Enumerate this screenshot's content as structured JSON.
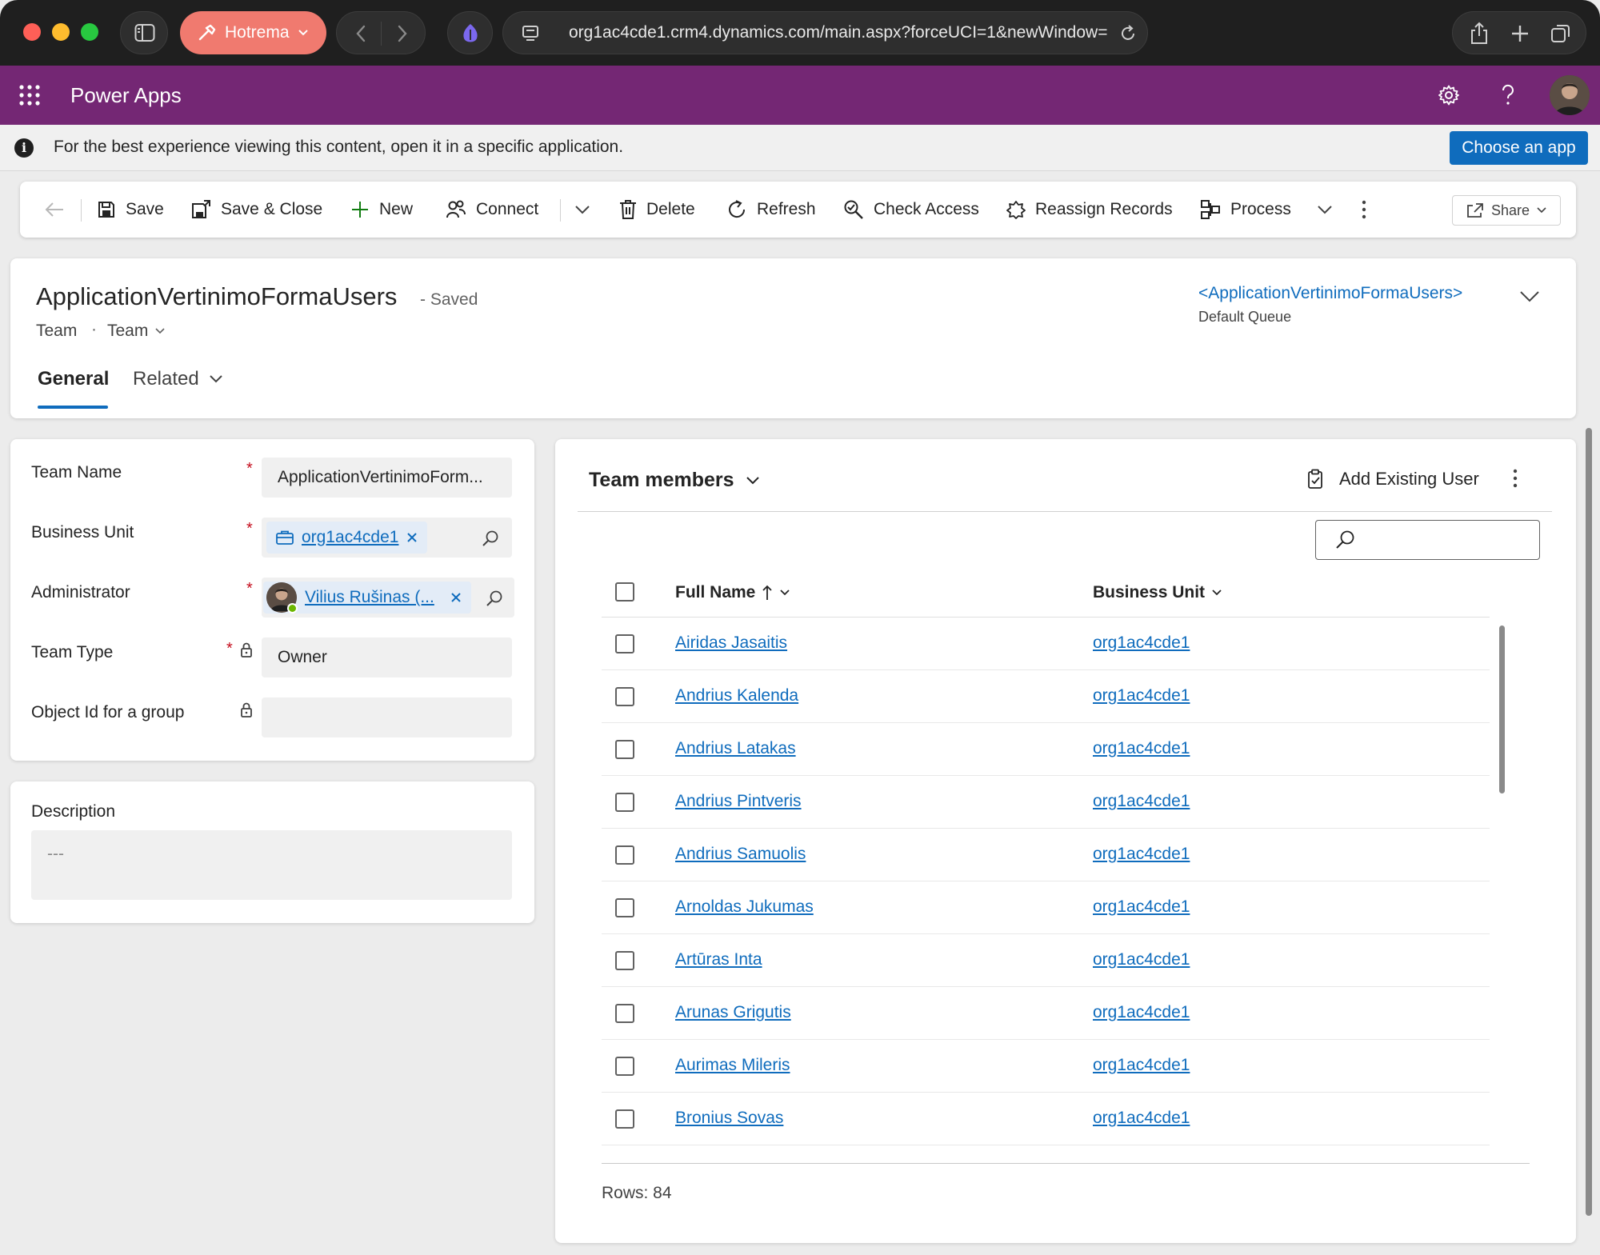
{
  "browser": {
    "profile_label": "Hotrema",
    "url": "org1ac4cde1.crm4.dynamics.com/main.aspx?forceUCI=1&newWindow="
  },
  "app": {
    "title": "Power Apps",
    "brand_color": "#742774"
  },
  "info_bar": {
    "message": "For the best experience viewing this content, open it in a specific application.",
    "button": "Choose an app"
  },
  "command_bar": {
    "save": "Save",
    "save_close": "Save & Close",
    "new": "New",
    "connect": "Connect",
    "delete": "Delete",
    "refresh": "Refresh",
    "check_access": "Check Access",
    "reassign": "Reassign Records",
    "process": "Process",
    "share": "Share"
  },
  "record": {
    "title": "ApplicationVertinimoFormaUsers",
    "status": "- Saved",
    "entity": "Team",
    "separator": "·",
    "form_name": "Team",
    "owner_link": "<ApplicationVertinimoFormaUsers>",
    "owner_label": "Default Queue",
    "tabs": [
      "General",
      "Related"
    ]
  },
  "form": {
    "team_name_label": "Team Name",
    "team_name_value": "ApplicationVertinimoForm...",
    "business_unit_label": "Business Unit",
    "business_unit_value": "org1ac4cde1",
    "administrator_label": "Administrator",
    "administrator_value": "Vilius Rušinas (...",
    "team_type_label": "Team Type",
    "team_type_value": "Owner",
    "object_id_label": "Object Id for a group",
    "required_marker": "*",
    "description_label": "Description",
    "description_placeholder": "---"
  },
  "subgrid": {
    "title": "Team members",
    "add_existing": "Add Existing User",
    "columns": [
      "Full Name",
      "Business Unit"
    ],
    "rows": [
      {
        "name": "Airidas Jasaitis",
        "bu": "org1ac4cde1"
      },
      {
        "name": "Andrius Kalenda",
        "bu": "org1ac4cde1"
      },
      {
        "name": "Andrius Latakas",
        "bu": "org1ac4cde1"
      },
      {
        "name": "Andrius Pintveris",
        "bu": "org1ac4cde1"
      },
      {
        "name": "Andrius Samuolis",
        "bu": "org1ac4cde1"
      },
      {
        "name": "Arnoldas Jukumas",
        "bu": "org1ac4cde1"
      },
      {
        "name": "Artūras Inta",
        "bu": "org1ac4cde1"
      },
      {
        "name": "Arunas Grigutis",
        "bu": "org1ac4cde1"
      },
      {
        "name": "Aurimas Mileris",
        "bu": "org1ac4cde1"
      },
      {
        "name": "Bronius Sovas",
        "bu": "org1ac4cde1"
      }
    ],
    "rows_count": "Rows: 84"
  },
  "icons": {
    "apps": "waffle-icon",
    "settings": "gear-icon",
    "help": "question-icon"
  },
  "colors": {
    "accent": "#0f6cbd",
    "required": "#c50f1f"
  }
}
